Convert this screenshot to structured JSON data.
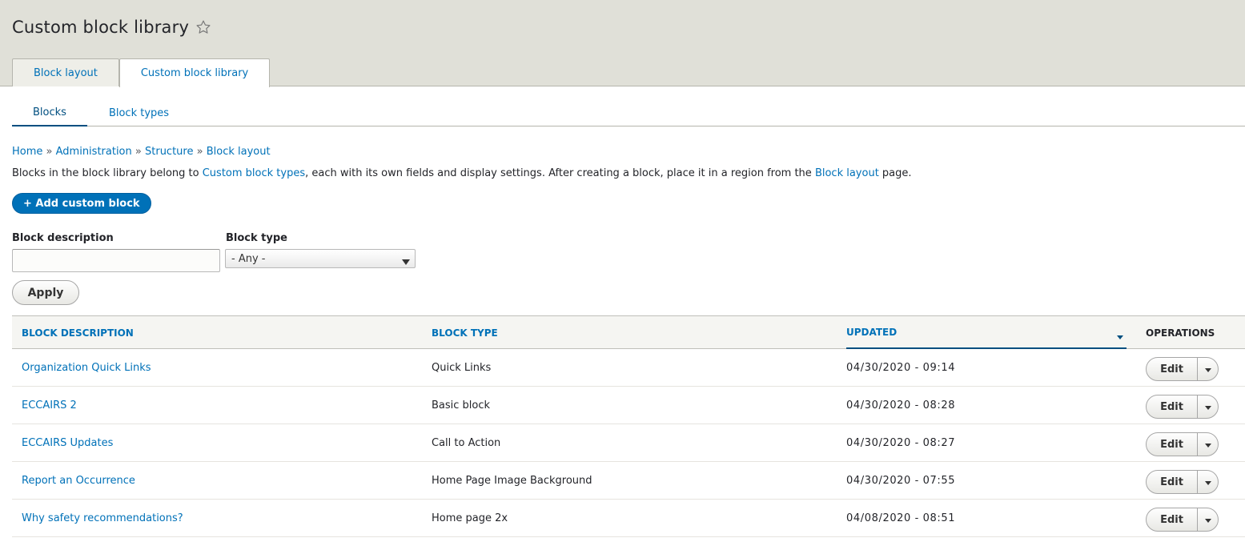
{
  "page": {
    "title": "Custom block library"
  },
  "primary_tabs": [
    {
      "label": "Block layout",
      "active": false
    },
    {
      "label": "Custom block library",
      "active": true
    }
  ],
  "secondary_tabs": [
    {
      "label": "Blocks",
      "active": true
    },
    {
      "label": "Block types",
      "active": false
    }
  ],
  "breadcrumb": {
    "items": [
      "Home",
      "Administration",
      "Structure",
      "Block layout"
    ],
    "separator": "»"
  },
  "description": {
    "part1": "Blocks in the block library belong to ",
    "link1": "Custom block types",
    "part2": ", each with its own fields and display settings. After creating a block, place it in a region from the ",
    "link2": "Block layout",
    "part3": " page."
  },
  "add_button": "+ Add custom block",
  "filters": {
    "description_label": "Block description",
    "description_value": "",
    "type_label": "Block type",
    "type_selected": "- Any -",
    "apply_label": "Apply"
  },
  "table": {
    "headers": {
      "description": "Block description",
      "type": "Block type",
      "updated": "Updated",
      "operations": "Operations"
    },
    "rows": [
      {
        "description": "Organization Quick Links",
        "type": "Quick Links",
        "updated": "04/30/2020 - 09:14",
        "operation": "Edit"
      },
      {
        "description": "ECCAIRS 2",
        "type": "Basic block",
        "updated": "04/30/2020 - 08:28",
        "operation": "Edit"
      },
      {
        "description": "ECCAIRS Updates",
        "type": "Call to Action",
        "updated": "04/30/2020 - 08:27",
        "operation": "Edit"
      },
      {
        "description": "Report an Occurrence",
        "type": "Home Page Image Background",
        "updated": "04/30/2020 - 07:55",
        "operation": "Edit"
      },
      {
        "description": "Why safety recommendations?",
        "type": "Home page 2x",
        "updated": "04/08/2020 - 08:51",
        "operation": "Edit"
      }
    ]
  },
  "colors": {
    "link": "#0071b8",
    "header_bg": "#e0e0d8",
    "primary_button": "#0071b8"
  },
  "icons": {
    "favorite": "star-outline-icon",
    "sort": "triangle-down-icon",
    "dropdown": "caret-down-icon"
  }
}
